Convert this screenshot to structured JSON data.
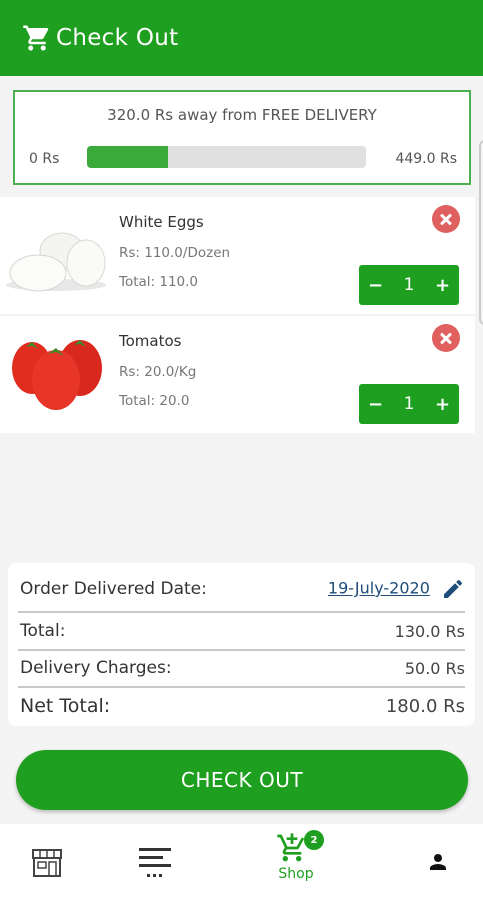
{
  "header": {
    "title": "Check Out",
    "icon": "cart-icon"
  },
  "delivery": {
    "message": "320.0 Rs away from FREE DELIVERY",
    "min_label": "0 Rs",
    "max_label": "449.0 Rs",
    "progress_fraction": 0.29
  },
  "cart_items": [
    {
      "name": "White Eggs",
      "price": "Rs: 110.0/Dozen",
      "total": "Total: 110.0",
      "quantity": "1",
      "minus": "−",
      "plus": "+"
    },
    {
      "name": "Tomatos",
      "price": "Rs: 20.0/Kg",
      "total": "Total: 20.0",
      "quantity": "1",
      "minus": "−",
      "plus": "+"
    }
  ],
  "summary": {
    "delivery_date_label": "Order Delivered Date:",
    "delivery_date": "19-July-2020",
    "total_label": "Total:",
    "total_value": "130.0 Rs",
    "charges_label": "Delivery Charges:",
    "charges_value": "50.0 Rs",
    "net_label": "Net Total:",
    "net_value": "180.0 Rs"
  },
  "checkout_button": "CHECK OUT",
  "bottom_nav": {
    "shop_label": "Shop",
    "cart_badge": "2",
    "items": [
      "store-icon",
      "menu-icon",
      "cart-add-icon",
      "person-icon"
    ]
  },
  "colors": {
    "primary": "#1f9f1f",
    "remove": "#e06060",
    "link": "#1e4d7a"
  }
}
